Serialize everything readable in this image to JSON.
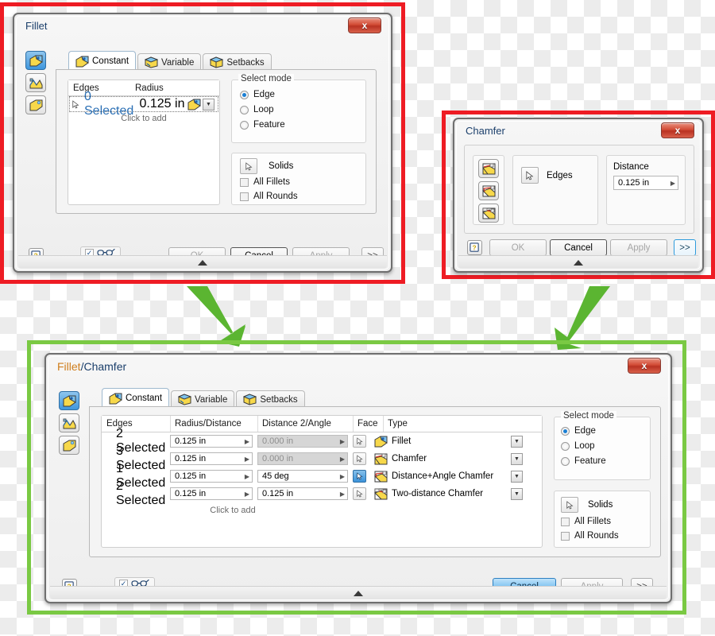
{
  "theme": {
    "frame_red": "#ee1c24",
    "frame_green": "#7ac943",
    "arrow_green": "#5bb531",
    "accent_blue": "#1a7fd4",
    "title_blue": "#1b3f6b",
    "title_orange": "#cf7e1d",
    "link_blue": "#2a6fb5"
  },
  "fillet_dialog": {
    "title": "Fillet",
    "close_label": "x",
    "side_buttons": [
      {
        "name": "constant-radius-fillet",
        "selected": true
      },
      {
        "name": "face-fillet",
        "selected": false
      },
      {
        "name": "full-round-fillet",
        "selected": false
      }
    ],
    "tabs": [
      {
        "label": "Constant",
        "active": true,
        "icon": "fillet-icon"
      },
      {
        "label": "Variable",
        "active": false,
        "icon": "variable-fillet-icon"
      },
      {
        "label": "Setbacks",
        "active": false,
        "icon": "setbacks-icon"
      }
    ],
    "table": {
      "columns": [
        "Edges",
        "Radius"
      ],
      "rows": [
        {
          "edges": "0 Selected",
          "radius": "0.125 in"
        }
      ],
      "add_hint": "Click to add"
    },
    "select_mode": {
      "label": "Select mode",
      "options": [
        {
          "label": "Edge",
          "selected": true
        },
        {
          "label": "Loop",
          "selected": false
        },
        {
          "label": "Feature",
          "selected": false
        }
      ]
    },
    "solids": {
      "button_label": "Solids",
      "checkboxes": [
        {
          "label": "All Fillets",
          "checked": false
        },
        {
          "label": "All Rounds",
          "checked": false
        }
      ]
    },
    "footer": {
      "help_label": "?",
      "preview_checked": true,
      "buttons": [
        {
          "label": "OK",
          "state": "disabled"
        },
        {
          "label": "Cancel",
          "state": "strong"
        },
        {
          "label": "Apply",
          "state": "disabled"
        },
        {
          "label": ">>",
          "state": "normal"
        }
      ]
    }
  },
  "chamfer_dialog": {
    "title": "Chamfer",
    "close_label": "x",
    "side_buttons": [
      {
        "name": "distance-chamfer",
        "selected": true
      },
      {
        "name": "distance-angle-chamfer",
        "selected": false
      },
      {
        "name": "two-distance-chamfer",
        "selected": false
      }
    ],
    "edges_label": "Edges",
    "distance": {
      "label": "Distance",
      "value": "0.125 in"
    },
    "footer": {
      "help_label": "?",
      "buttons": [
        {
          "label": "OK",
          "state": "disabled"
        },
        {
          "label": "Cancel",
          "state": "strong"
        },
        {
          "label": "Apply",
          "state": "disabled"
        },
        {
          "label": ">>",
          "state": "blueoutline"
        }
      ]
    }
  },
  "filletchamfer_dialog": {
    "title_part1": "Fillet",
    "title_sep": "/",
    "title_part2": "Chamfer",
    "close_label": "x",
    "side_buttons": [
      {
        "name": "constant-radius-fillet",
        "selected": true
      },
      {
        "name": "face-fillet",
        "selected": false
      },
      {
        "name": "full-round-fillet",
        "selected": false
      }
    ],
    "tabs": [
      {
        "label": "Constant",
        "active": true,
        "icon": "fillet-icon"
      },
      {
        "label": "Variable",
        "active": false,
        "icon": "variable-fillet-icon"
      },
      {
        "label": "Setbacks",
        "active": false,
        "icon": "setbacks-icon"
      }
    ],
    "table": {
      "columns": [
        "Edges",
        "Radius/Distance",
        "Distance 2/Angle",
        "Face",
        "Type"
      ],
      "rows": [
        {
          "edges": "2 Selected",
          "radius": "0.125 in",
          "distance2": "0.000 in",
          "distance2_disabled": true,
          "face_selected": false,
          "type": "Fillet",
          "type_icon": "fillet-icon"
        },
        {
          "edges": "3 Selected",
          "radius": "0.125 in",
          "distance2": "0.000 in",
          "distance2_disabled": true,
          "face_selected": false,
          "type": "Chamfer",
          "type_icon": "chamfer-icon"
        },
        {
          "edges": "1 Selected",
          "radius": "0.125 in",
          "distance2": "45 deg",
          "distance2_disabled": false,
          "face_selected": true,
          "type": "Distance+Angle Chamfer",
          "type_icon": "distance-angle-chamfer-icon"
        },
        {
          "edges": "2 Selected",
          "radius": "0.125 in",
          "distance2": "0.125 in",
          "distance2_disabled": false,
          "face_selected": false,
          "type": "Two-distance Chamfer",
          "type_icon": "two-distance-chamfer-icon"
        }
      ],
      "add_hint": "Click to add"
    },
    "select_mode": {
      "label": "Select mode",
      "options": [
        {
          "label": "Edge",
          "selected": true
        },
        {
          "label": "Loop",
          "selected": false
        },
        {
          "label": "Feature",
          "selected": false
        }
      ]
    },
    "solids": {
      "button_label": "Solids",
      "checkboxes": [
        {
          "label": "All Fillets",
          "checked": false
        },
        {
          "label": "All Rounds",
          "checked": false
        }
      ]
    },
    "footer": {
      "help_label": "?",
      "preview_checked": true,
      "buttons": [
        {
          "label": "Cancel",
          "state": "highlight"
        },
        {
          "label": "Apply",
          "state": "disabled"
        },
        {
          "label": ">>",
          "state": "normal"
        }
      ]
    }
  }
}
